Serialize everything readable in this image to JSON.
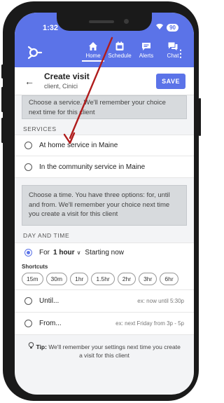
{
  "status": {
    "time": "1:32",
    "battery": "90"
  },
  "nav": {
    "items": [
      {
        "label": "Home",
        "icon": "home-icon"
      },
      {
        "label": "Schedule",
        "icon": "calendar-icon"
      },
      {
        "label": "Alerts",
        "icon": "message-icon"
      },
      {
        "label": "Chat",
        "icon": "chat-icon"
      }
    ]
  },
  "header": {
    "title": "Create visit",
    "subtitle": "client, Cinici",
    "save_label": "SAVE"
  },
  "service_hint": "Choose a service. We'll remember your choice next time for this client",
  "services": {
    "label": "SERVICES",
    "options": [
      "At home service in Maine",
      "In the community service in Maine"
    ]
  },
  "time_hint": "Choose a time. You have three options: for, until and from. We'll remember your choice next time you create a visit for this client",
  "day_time": {
    "label": "DAY AND TIME",
    "for_label": "For",
    "duration": "1 hour",
    "starting": "Starting now",
    "shortcuts_label": "Shortcuts",
    "shortcuts": [
      "15m",
      "30m",
      "1hr",
      "1.5hr",
      "2hr",
      "3hr",
      "6hr"
    ],
    "until_label": "Until...",
    "until_hint": "ex: now until 5:30p",
    "from_label": "From...",
    "from_hint": "ex: next Friday from 3p - 5p"
  },
  "tip": {
    "prefix": "Tip:",
    "text": "We'll remember your settings next time you create a visit for this client"
  },
  "colors": {
    "brand": "#5b73e8",
    "arrow": "#b01c1c"
  }
}
